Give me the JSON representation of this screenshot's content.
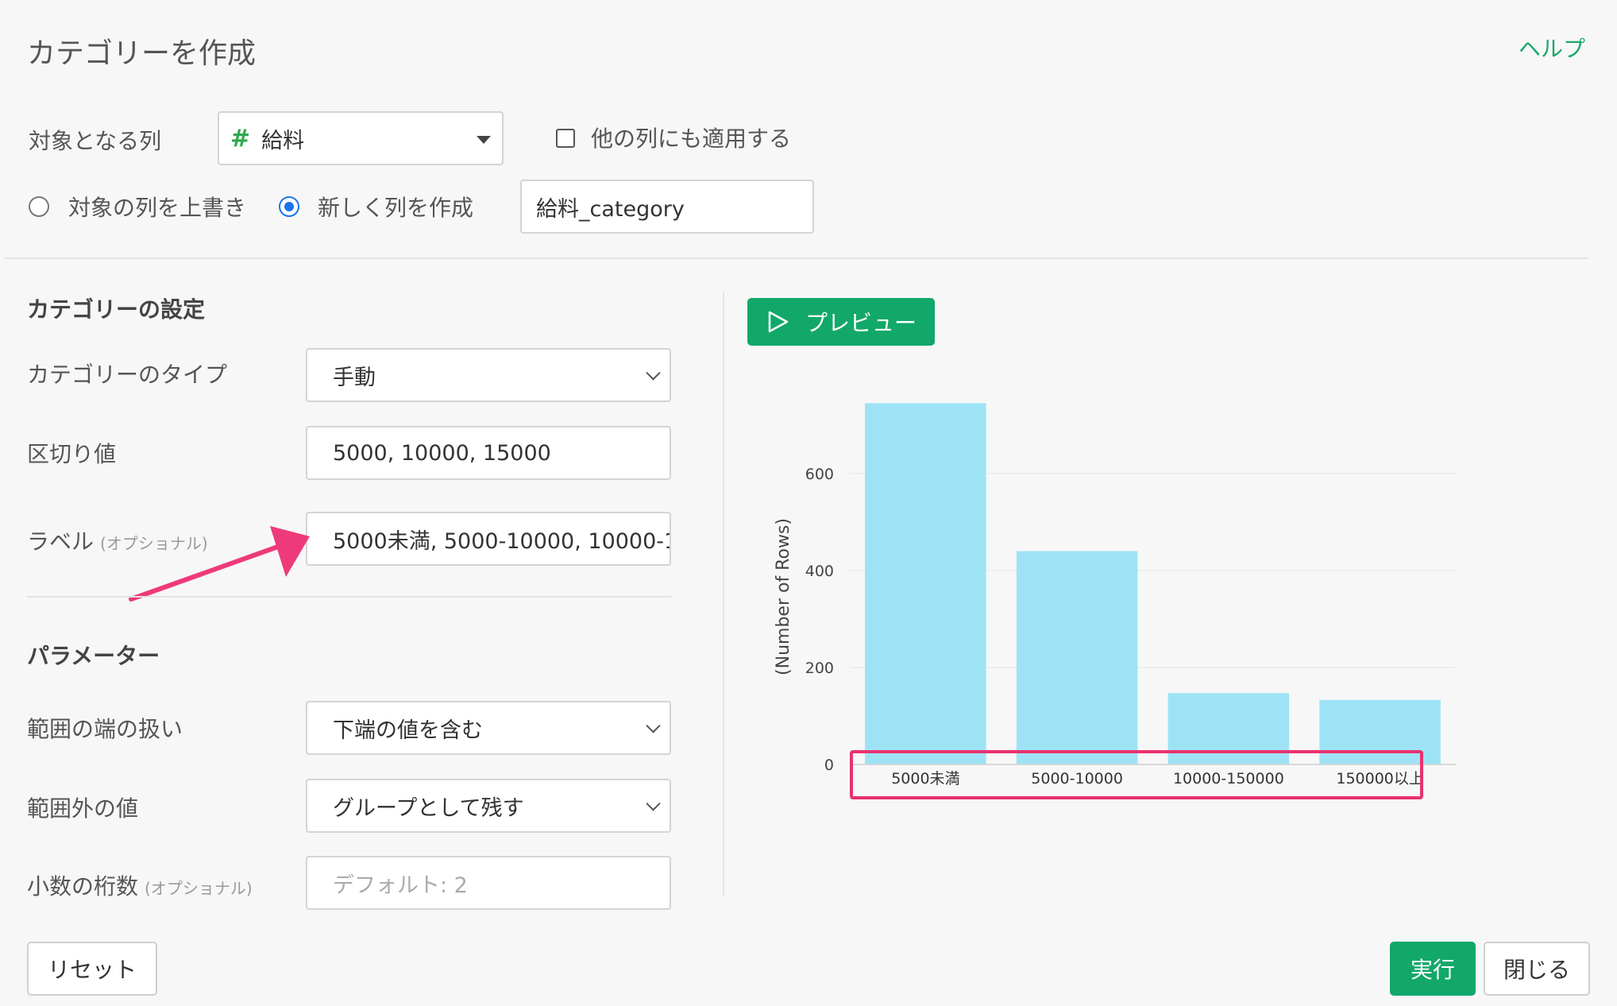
{
  "header": {
    "title": "カテゴリーを作成",
    "help": "ヘルプ"
  },
  "target": {
    "label": "対象となる列",
    "column_icon": "#",
    "column_value": "給料",
    "apply_other_label": "他の列にも適用する",
    "apply_other_checked": false
  },
  "mode": {
    "overwrite_label": "対象の列を上書き",
    "create_label": "新しく列を作成",
    "selected": "create",
    "new_column_name": "給料_category"
  },
  "category_settings": {
    "heading": "カテゴリーの設定",
    "type_label": "カテゴリーのタイプ",
    "type_value": "手動",
    "breaks_label": "区切り値",
    "breaks_value": "5000, 10000, 15000",
    "labels_label": "ラベル",
    "labels_optional": "(オプショナル)",
    "labels_value": "5000未満, 5000-10000, 10000-1"
  },
  "parameters": {
    "heading": "パラメーター",
    "edge_label": "範囲の端の扱い",
    "edge_value": "下端の値を含む",
    "outside_label": "範囲外の値",
    "outside_value": "グループとして残す",
    "digits_label": "小数の桁数",
    "digits_optional": "(オプショナル)",
    "digits_placeholder": "デフォルト: 2"
  },
  "preview_button": "プレビュー",
  "footer": {
    "reset": "リセット",
    "run": "実行",
    "close": "閉じる"
  },
  "colors": {
    "accent": "#12a86a",
    "bar": "#9ee3f5",
    "highlight": "#e8326f",
    "radio": "#1a73e8"
  },
  "chart_data": {
    "type": "bar",
    "categories": [
      "5000未満",
      "5000-10000",
      "10000-150000",
      "150000以上"
    ],
    "values": [
      745,
      440,
      147,
      133
    ],
    "ylabel": "(Number of Rows)",
    "yticks": [
      0,
      200,
      400,
      600
    ],
    "ylim": [
      0,
      780
    ],
    "grid": true
  }
}
